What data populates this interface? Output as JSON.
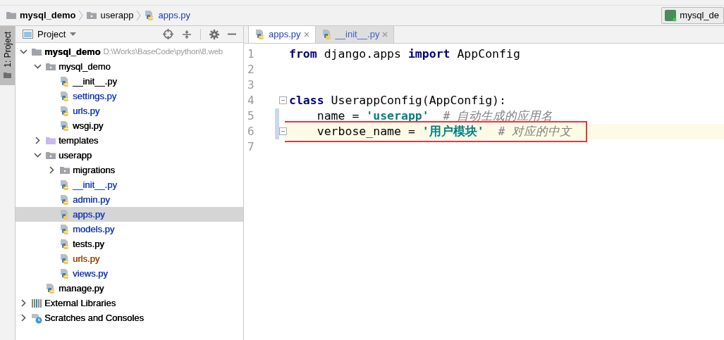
{
  "breadcrumb": [
    {
      "label": "mysql_demo",
      "kind": "project"
    },
    {
      "label": "userapp",
      "kind": "folder"
    },
    {
      "label": "apps.py",
      "kind": "file"
    }
  ],
  "run_config": {
    "label": "mysql_de"
  },
  "side_tab": {
    "label": "1: Project",
    "selected": true
  },
  "project_panel": {
    "title": "Project",
    "tree": [
      {
        "label": "mysql_demo",
        "kind": "project",
        "path": "D:\\Works\\BaseCode\\python\\8.web",
        "expanded": true,
        "selected": false,
        "color": "#000000",
        "children": [
          {
            "label": "mysql_demo",
            "kind": "package",
            "expanded": true,
            "selected": false,
            "color": "#000000",
            "children": [
              {
                "label": "__init__.py",
                "kind": "python",
                "selected": false,
                "color": "#000000"
              },
              {
                "label": "settings.py",
                "kind": "python",
                "selected": false,
                "color": "#1a3fb8"
              },
              {
                "label": "urls.py",
                "kind": "python",
                "selected": false,
                "color": "#1a3fb8"
              },
              {
                "label": "wsgi.py",
                "kind": "python",
                "selected": false,
                "color": "#000000"
              }
            ]
          },
          {
            "label": "templates",
            "kind": "templates",
            "expanded": false,
            "selected": false,
            "color": "#000000"
          },
          {
            "label": "userapp",
            "kind": "package",
            "expanded": true,
            "selected": false,
            "color": "#000000",
            "children": [
              {
                "label": "migrations",
                "kind": "package",
                "expanded": false,
                "selected": false,
                "color": "#000000"
              },
              {
                "label": "__init__.py",
                "kind": "python",
                "selected": false,
                "color": "#1a3fb8"
              },
              {
                "label": "admin.py",
                "kind": "python",
                "selected": false,
                "color": "#1a3fb8"
              },
              {
                "label": "apps.py",
                "kind": "python",
                "selected": true,
                "color": "#1a3fb8"
              },
              {
                "label": "models.py",
                "kind": "python",
                "selected": false,
                "color": "#1a3fb8"
              },
              {
                "label": "tests.py",
                "kind": "python",
                "selected": false,
                "color": "#000000"
              },
              {
                "label": "urls.py",
                "kind": "python",
                "selected": false,
                "color": "#9c4a0c"
              },
              {
                "label": "views.py",
                "kind": "python",
                "selected": false,
                "color": "#1a3fb8"
              }
            ]
          },
          {
            "label": "manage.py",
            "kind": "python",
            "selected": false,
            "color": "#000000"
          }
        ]
      },
      {
        "label": "External Libraries",
        "kind": "libraries",
        "expanded": false,
        "selected": false,
        "color": "#000000"
      },
      {
        "label": "Scratches and Consoles",
        "kind": "scratches",
        "expanded": false,
        "selected": false,
        "color": "#000000"
      }
    ]
  },
  "editor": {
    "tabs": [
      {
        "label": "apps.py",
        "selected": true
      },
      {
        "label": "__init__.py",
        "selected": false
      }
    ],
    "lines": [
      {
        "number": "1",
        "tokens": [
          {
            "kind": "keyword",
            "text": "from"
          },
          {
            "kind": "plain",
            "text": " django.apps "
          },
          {
            "kind": "keyword",
            "text": "import"
          },
          {
            "kind": "plain",
            "text": " AppConfig"
          }
        ]
      },
      {
        "number": "2"
      },
      {
        "number": "3"
      },
      {
        "number": "4",
        "fold": true,
        "tokens": [
          {
            "kind": "keyword",
            "text": "class"
          },
          {
            "kind": "plain",
            "text": " UserappConfig(AppConfig):"
          }
        ]
      },
      {
        "number": "5",
        "changed": true,
        "tokens": [
          {
            "kind": "plain",
            "text": "    name = "
          },
          {
            "kind": "string",
            "text": "'userapp'"
          },
          {
            "kind": "comment",
            "text": "# 自动生成的应用名"
          }
        ]
      },
      {
        "number": "6",
        "current": true,
        "boxed": true,
        "changed": true,
        "fold": true,
        "tokens": [
          {
            "kind": "plain",
            "text": "    verbose_name = "
          },
          {
            "kind": "string",
            "text": "'用户模块'"
          },
          {
            "kind": "comment",
            "text": "# 对应的中文"
          }
        ]
      },
      {
        "number": "7"
      }
    ]
  }
}
